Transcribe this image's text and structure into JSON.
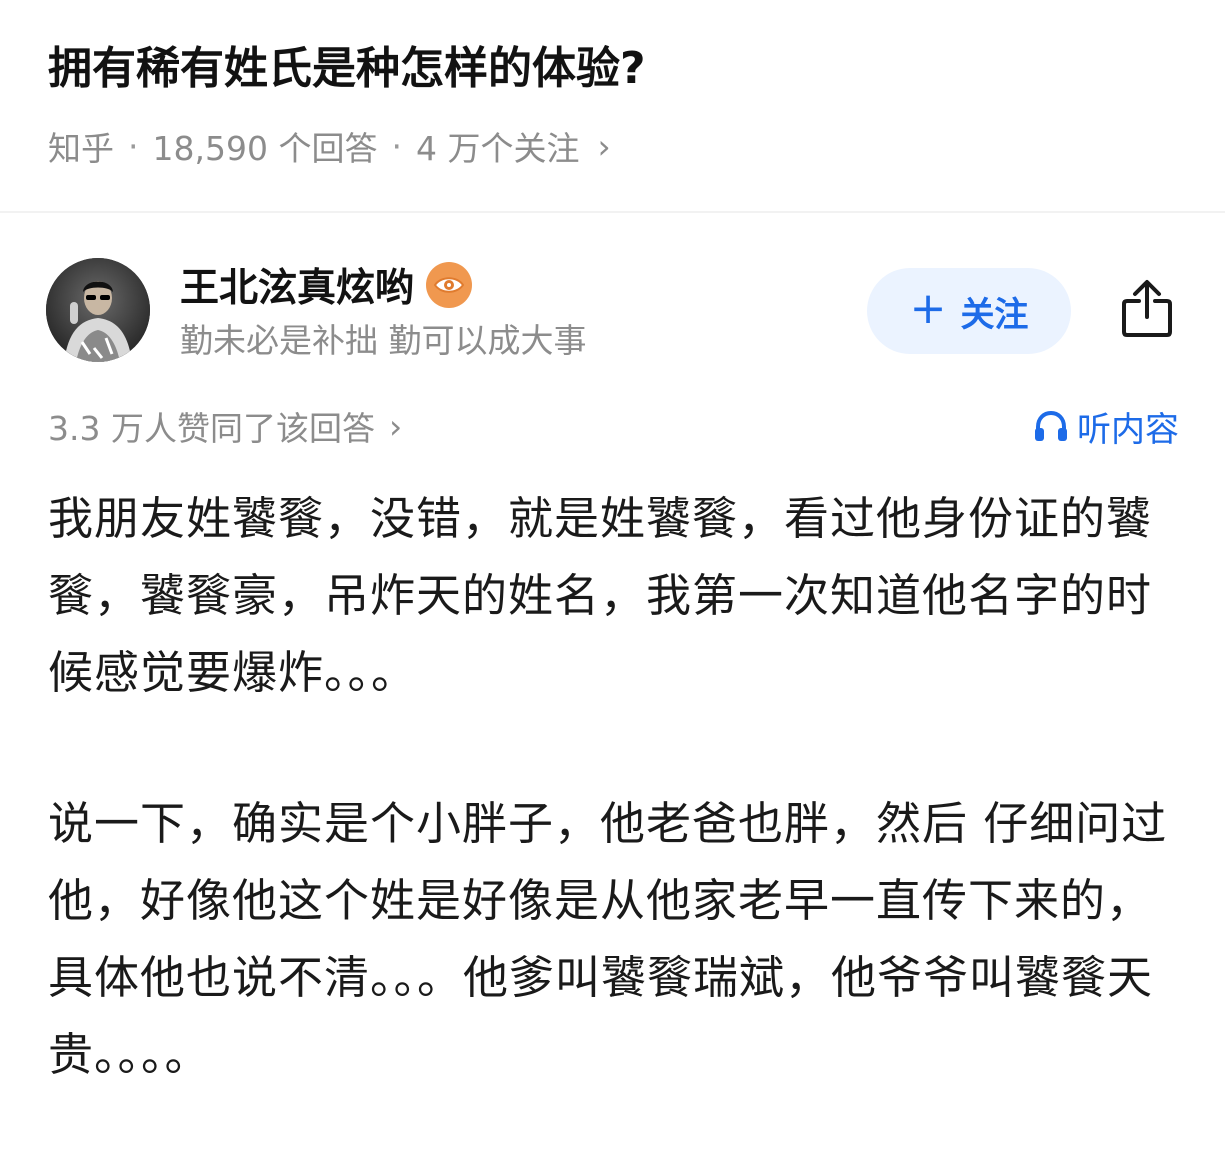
{
  "question": {
    "title": "拥有稀有姓氏是种怎样的体验?",
    "source": "知乎",
    "separator": "·",
    "answer_count": "18,590 个回答",
    "follower_count": "4 万个关注",
    "chevron": "›"
  },
  "author": {
    "name": "王北泫真炫哟",
    "bio": "勤未必是补拙 勤可以成大事",
    "badge_icon": "eye-badge-icon",
    "badge_color": "#f0984f"
  },
  "actions": {
    "follow_plus": "+",
    "follow_label": "关注",
    "share_icon": "share-icon",
    "accent_color": "#1d6be8"
  },
  "answer": {
    "votes": "3.3 万人赞同了该回答",
    "votes_chevron": "›",
    "listen_label": "听内容",
    "listen_icon": "headphones-icon",
    "paragraphs": [
      "我朋友姓饕餮，没错，就是姓饕餮，看过他身份证的饕餮，饕餮豪，吊炸天的姓名，我第一次知道他名字的时候感觉要爆炸。。。",
      "说一下，确实是个小胖子，他老爸也胖，然后 仔细问过他，好像他这个姓是好像是从他家老早一直传下来的，具体他也说不清。。。他爹叫饕餮瑞斌，他爷爷叫饕餮天贵。。。。"
    ]
  }
}
